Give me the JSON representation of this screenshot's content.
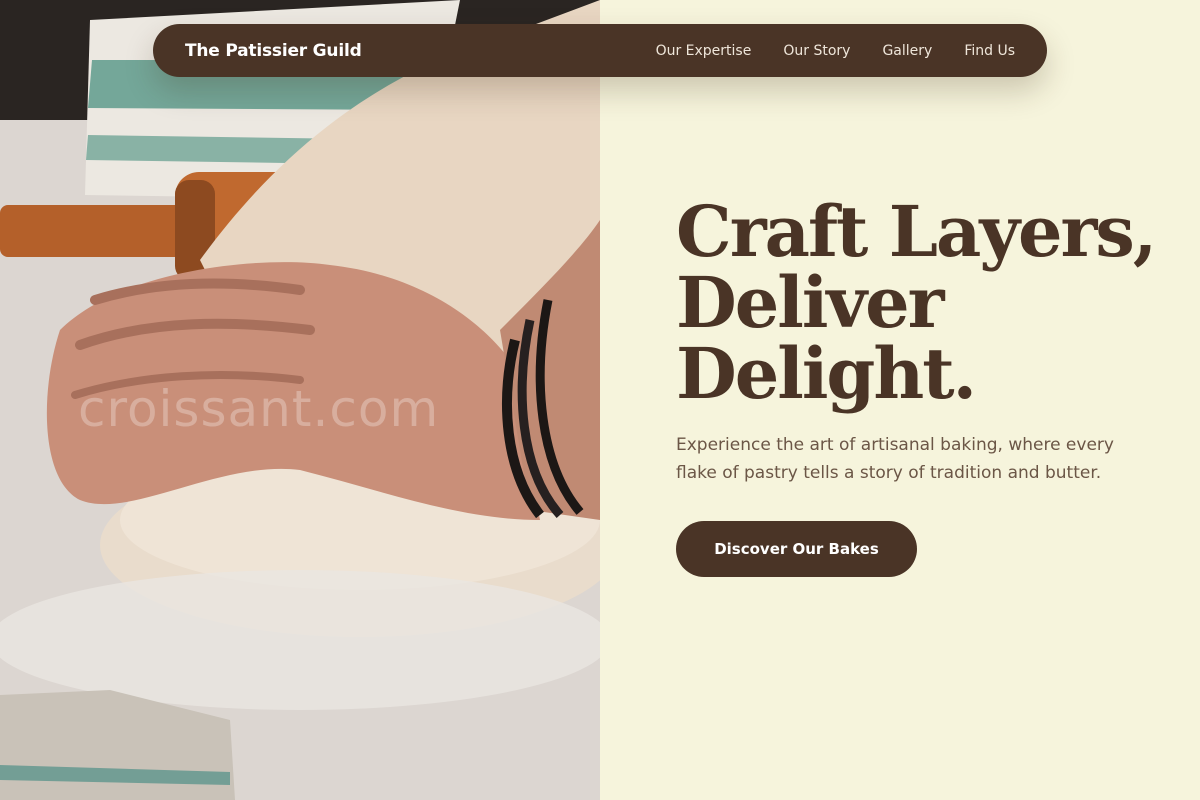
{
  "nav": {
    "brand": "The Patissier Guild",
    "links": [
      {
        "label": "Our Expertise"
      },
      {
        "label": "Our Story"
      },
      {
        "label": "Gallery"
      },
      {
        "label": "Find Us"
      }
    ]
  },
  "hero": {
    "title_lines": [
      "Craft Layers,",
      "Deliver",
      "Delight."
    ],
    "subtitle": "Experience the art of artisanal baking, where every flake of pastry tells a story of tradition and butter.",
    "cta_label": "Discover Our Bakes"
  },
  "photo": {
    "watermark": "croissant.com",
    "subject": "hands-kneading-dough"
  },
  "colors": {
    "brand_brown": "#4a3426",
    "cream_background": "#f6f4dc",
    "body_text": "#6b5646"
  }
}
